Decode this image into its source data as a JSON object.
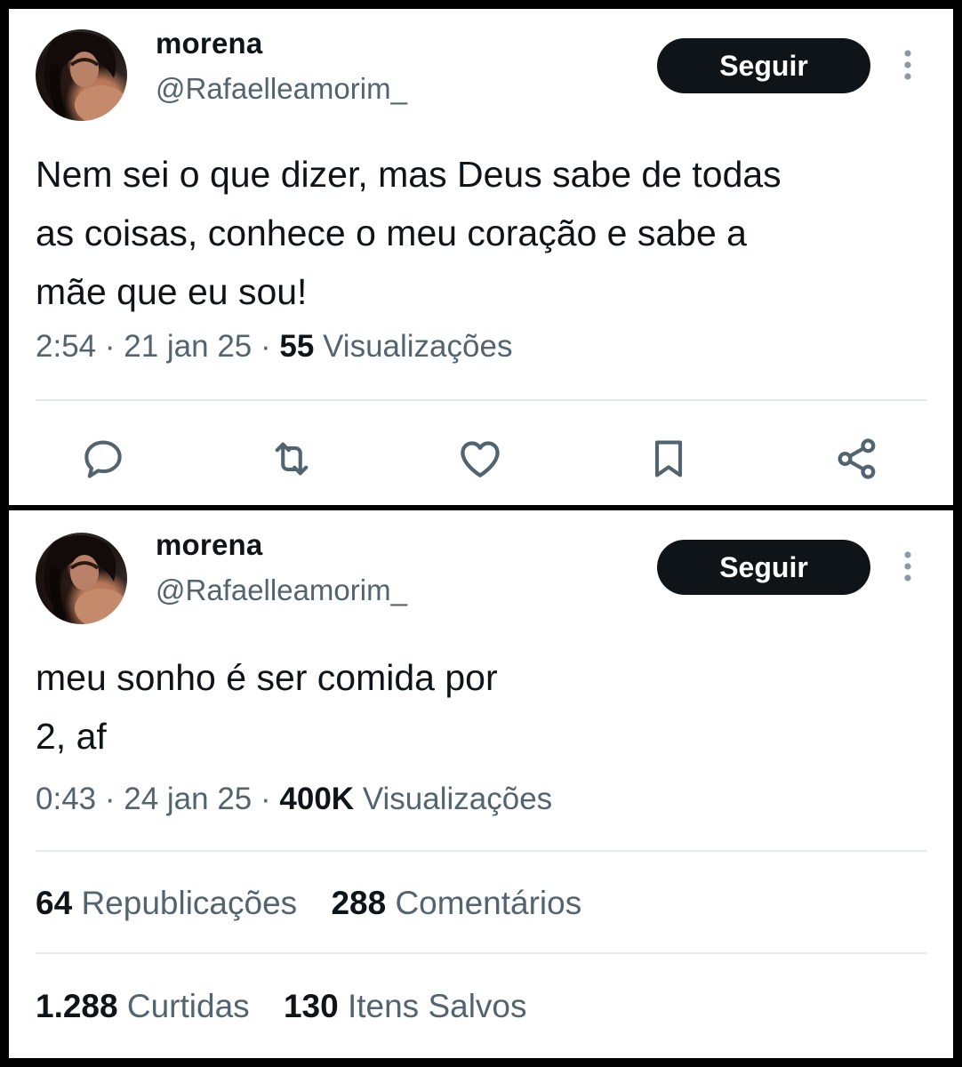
{
  "tweets": [
    {
      "display_name": "morena",
      "handle": "@Rafaelleamorim_",
      "follow_label": "Seguir",
      "text": "Nem sei o que dizer, mas Deus sabe de todas\nas coisas, conhece o meu coração e sabe a\nmãe que eu sou!",
      "time": "2:54",
      "date": "21 jan 25",
      "views_count": "55",
      "views_label": "Visualizações",
      "separator": "·",
      "actions": [
        {
          "icon": "reply-icon"
        },
        {
          "icon": "retweet-icon"
        },
        {
          "icon": "like-icon"
        },
        {
          "icon": "bookmark-icon"
        },
        {
          "icon": "share-icon"
        }
      ]
    },
    {
      "display_name": "morena",
      "handle": "@Rafaelleamorim_",
      "follow_label": "Seguir",
      "text": "meu sonho é ser comida por\n2, af",
      "time": "0:43",
      "date": "24 jan 25",
      "views_count": "400K",
      "views_label": "Visualizações",
      "separator": "·",
      "stats": {
        "reposts_count": "64",
        "reposts_label": "Republicações",
        "comments_count": "288",
        "comments_label": "Comentários",
        "likes_count": "1.288",
        "likes_label": "Curtidas",
        "saves_count": "130",
        "saves_label": "Itens Salvos"
      }
    }
  ],
  "colors": {
    "text": "#0f1419",
    "secondary": "#536471",
    "divider": "#e6e9eb",
    "button_bg": "#0f1419",
    "button_text": "#ffffff",
    "frame": "#000000"
  }
}
